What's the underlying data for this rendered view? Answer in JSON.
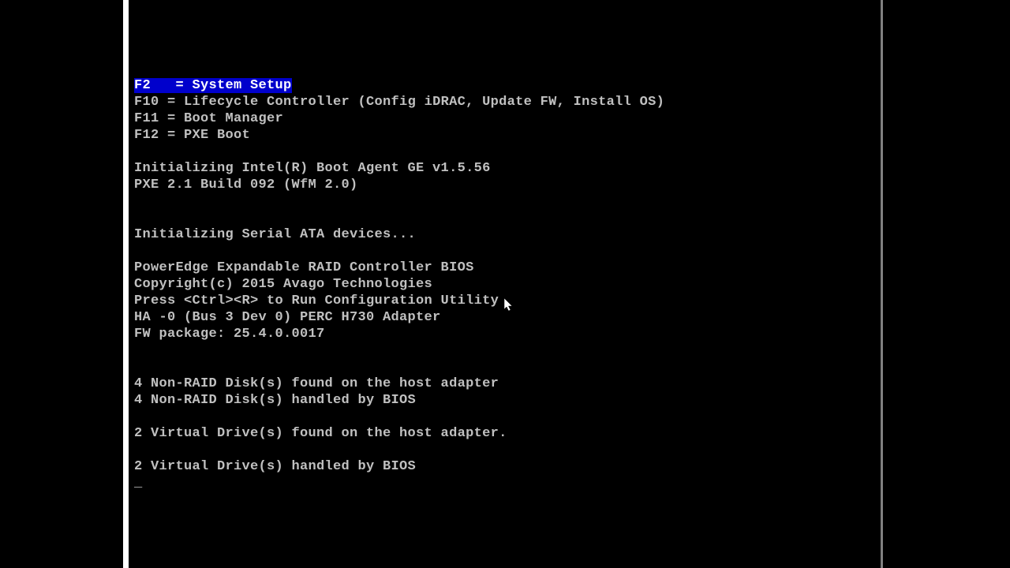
{
  "boot_menu": {
    "options": [
      {
        "key": "F2  ",
        "label": " = System Setup",
        "highlighted": true
      },
      {
        "key": "F10 ",
        "label": "= Lifecycle Controller (Config iDRAC, Update FW, Install OS)",
        "highlighted": false
      },
      {
        "key": "F11 ",
        "label": "= Boot Manager",
        "highlighted": false
      },
      {
        "key": "F12 ",
        "label": "= PXE Boot",
        "highlighted": false
      }
    ]
  },
  "boot_agent": {
    "init_line": "Initializing Intel(R) Boot Agent GE v1.5.56",
    "pxe_line": "PXE 2.1 Build 092 (WfM 2.0)"
  },
  "sata_init": "Initializing Serial ATA devices...",
  "raid": {
    "title": "PowerEdge Expandable RAID Controller BIOS",
    "copyright": "Copyright(c) 2015 Avago Technologies",
    "config_prompt": "Press <Ctrl><R> to Run Configuration Utility",
    "adapter": "HA -0 (Bus 3 Dev 0) PERC H730 Adapter",
    "fw_package": "FW package: 25.4.0.0017"
  },
  "disks": {
    "nonraid_found": "4 Non-RAID Disk(s) found on the host adapter",
    "nonraid_handled": "4 Non-RAID Disk(s) handled by BIOS",
    "virtual_found": "2 Virtual Drive(s) found on the host adapter.",
    "virtual_handled": "2 Virtual Drive(s) handled by BIOS"
  },
  "cursor_char": "_"
}
